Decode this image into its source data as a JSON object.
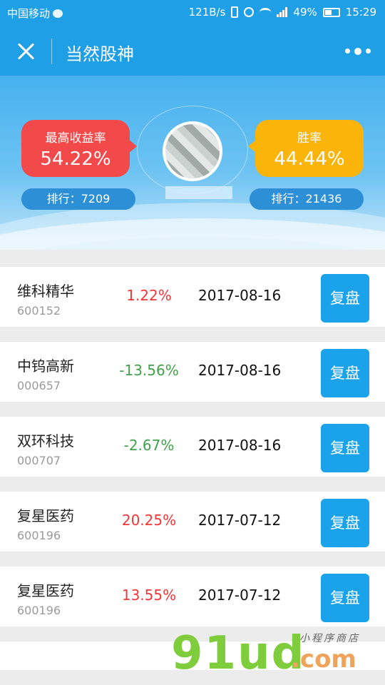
{
  "status_bar": {
    "carrier": "中国移动",
    "speed": "121B/s",
    "network": "4G",
    "battery": "49%",
    "time": "15:29"
  },
  "nav": {
    "title": "当然股神"
  },
  "hero": {
    "max_return_label": "最高收益率",
    "max_return_value": "54.22%",
    "max_return_rank": "排行：7209",
    "win_rate_label": "胜率",
    "win_rate_value": "44.44%",
    "win_rate_rank": "排行：21436"
  },
  "colors": {
    "primary": "#1f9fe6",
    "red_card": "#f2494a",
    "yellow_card": "#fbb40a",
    "gain": "#f2363a",
    "loss": "#3fa14a",
    "button": "#1aa3ea"
  },
  "rows": [
    {
      "name": "维科精华",
      "code": "600152",
      "pct": "1.22%",
      "trend": "up",
      "date": "2017-08-16",
      "button": "复盘"
    },
    {
      "name": "中钨高新",
      "code": "000657",
      "pct": "-13.56%",
      "trend": "down",
      "date": "2017-08-16",
      "button": "复盘"
    },
    {
      "name": "双环科技",
      "code": "000707",
      "pct": "-2.67%",
      "trend": "down",
      "date": "2017-08-16",
      "button": "复盘"
    },
    {
      "name": "复星医药",
      "code": "600196",
      "pct": "20.25%",
      "trend": "up",
      "date": "2017-07-12",
      "button": "复盘"
    },
    {
      "name": "复星医药",
      "code": "600196",
      "pct": "13.55%",
      "trend": "up",
      "date": "2017-07-12",
      "button": "复盘"
    }
  ],
  "watermark": {
    "big": "91ud",
    "small": "小程序商店",
    "com": ".com"
  }
}
